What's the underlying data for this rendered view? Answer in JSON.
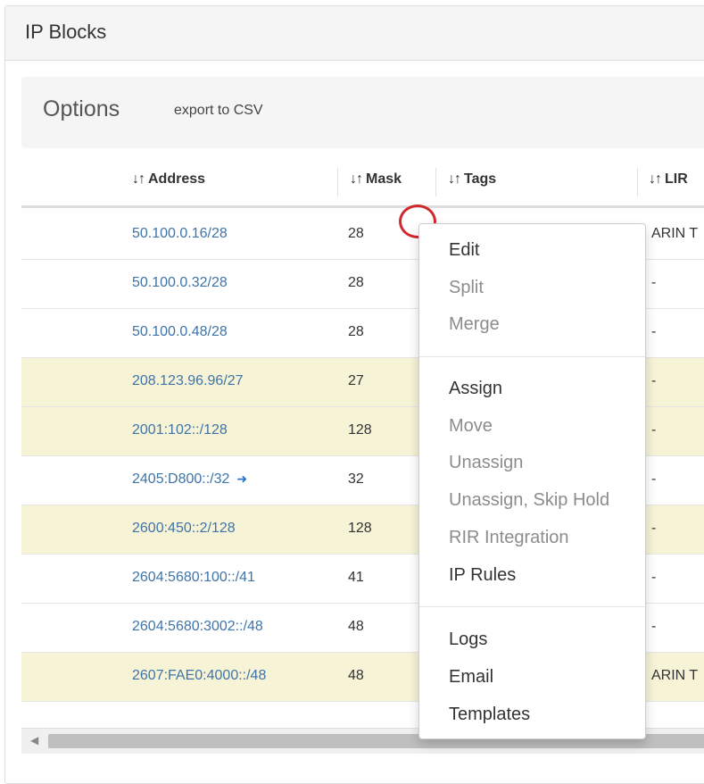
{
  "panel": {
    "title": "IP Blocks"
  },
  "options": {
    "title": "Options",
    "export_label": "export to CSV"
  },
  "table": {
    "sort_icon": "↓↑",
    "headers": {
      "address": "Address",
      "mask": "Mask",
      "tags": "Tags",
      "lir": "LIR"
    },
    "rows": [
      {
        "address": "50.100.0.16/28",
        "mask": "28",
        "lir": "ARIN T"
      },
      {
        "address": "50.100.0.32/28",
        "mask": "28",
        "lir": "-"
      },
      {
        "address": "50.100.0.48/28",
        "mask": "28",
        "lir": "-"
      },
      {
        "address": "208.123.96.96/27",
        "mask": "27",
        "lir": "-"
      },
      {
        "address": "2001:102::/128",
        "mask": "128",
        "lir": "-"
      },
      {
        "address": "2405:D800::/32",
        "mask": "32",
        "lir": "-"
      },
      {
        "address": "2600:450::2/128",
        "mask": "128",
        "lir": "-"
      },
      {
        "address": "2604:5680:100::/41",
        "mask": "41",
        "lir": "-"
      },
      {
        "address": "2604:5680:3002::/48",
        "mask": "48",
        "lir": "-"
      },
      {
        "address": "2607:FAE0:4000::/48",
        "mask": "48",
        "lir": "ARIN T"
      }
    ],
    "row_arrow": "➜"
  },
  "scrollbar": {
    "left_arrow": "◀"
  },
  "context_menu": {
    "items": [
      {
        "label": "Edit"
      },
      {
        "label": "Split"
      },
      {
        "label": "Merge"
      },
      {
        "label": "Assign"
      },
      {
        "label": "Move"
      },
      {
        "label": "Unassign"
      },
      {
        "label": "Unassign, Skip Hold"
      },
      {
        "label": "RIR Integration"
      },
      {
        "label": "IP Rules"
      },
      {
        "label": "Logs"
      },
      {
        "label": "Email"
      },
      {
        "label": "Templates"
      }
    ]
  },
  "colors": {
    "link": "#3f74a8",
    "highlight_row": "#f6f3d7",
    "marker": "#d0282d",
    "disabled_text": "#8c8c8c"
  }
}
